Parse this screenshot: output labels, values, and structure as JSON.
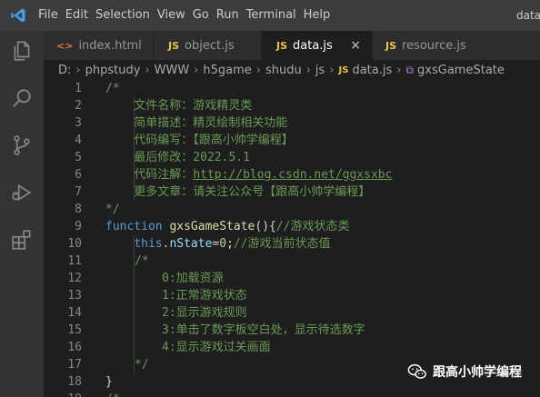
{
  "titlebar": {
    "menu": [
      "File",
      "Edit",
      "Selection",
      "View",
      "Go",
      "Run",
      "Terminal",
      "Help"
    ],
    "window_title": "data.j"
  },
  "tabs": [
    {
      "icon": "<>",
      "label": "index.html",
      "active": false
    },
    {
      "icon": "JS",
      "label": "object.js",
      "active": false
    },
    {
      "icon": "JS",
      "label": "data.js",
      "active": true,
      "close": "×"
    },
    {
      "icon": "JS",
      "label": "resource.js",
      "active": false
    }
  ],
  "breadcrumb": {
    "parts": [
      "D:",
      "phpstudy",
      "WWW",
      "h5game",
      "shudu",
      "js"
    ],
    "file_icon": "JS",
    "file": "data.js",
    "symbol": "gxsGameState"
  },
  "editor": {
    "line_numbers": [
      "1",
      "2",
      "3",
      "4",
      "5",
      "6",
      "7",
      "8",
      "9",
      "10",
      "11",
      "12",
      "13",
      "14",
      "15",
      "16",
      "17",
      "18",
      "19"
    ],
    "lines": {
      "l1": "/*",
      "l2": "    文件名称：游戏精灵类",
      "l3": "    简单描述：精灵绘制相关功能",
      "l4": "    代码编写：【跟高小帅学编程】",
      "l5": "    最后修改：2022.5.1",
      "l6_prefix": "    代码注解：",
      "l6_link": "http://blog.csdn.net/ggxsxbc",
      "l7": "    更多文章：请关注公众号【跟高小帅学编程】",
      "l8": "*/",
      "l9_kw": "function",
      "l9_fn": "gxsGameState",
      "l9_punct": "(){",
      "l9_comment": "//游戏状态类",
      "l10_kw": "this",
      "l10_dot": ".",
      "l10_prop": "nState",
      "l10_eq": "=",
      "l10_num": "0",
      "l10_semi": ";",
      "l10_comment": "//游戏当前状态值",
      "l11": "/*",
      "l12": "0:加载资源",
      "l13": "1:正常游戏状态",
      "l14": "2:显示游戏规则",
      "l15": "3:单击了数字板空白处，显示待选数字",
      "l16": "4:显示游戏过关画面",
      "l17": "*/",
      "l18": "}",
      "l19": "/*"
    }
  },
  "watermark": {
    "text": "跟高小帅学编程"
  },
  "colors": {
    "comment": "#6a9955",
    "keyword": "#569cd6",
    "function": "#dcdcaa",
    "property": "#9cdcfe",
    "number": "#b5cea8",
    "js_icon": "#e8c44a",
    "vscode_blue": "#3ea1f0"
  }
}
